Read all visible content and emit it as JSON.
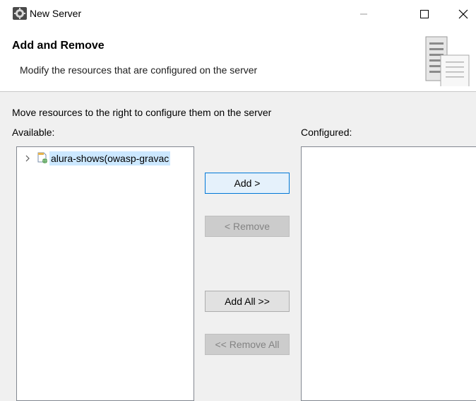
{
  "window": {
    "title": "New Server",
    "icons": {
      "app": "server-gear-icon",
      "minimize": "minimize-icon",
      "maximize": "maximize-icon",
      "close": "close-icon"
    }
  },
  "header": {
    "title": "Add and Remove",
    "description": "Modify the resources that are configured on the server",
    "banner_icon": "server-document-icon"
  },
  "body": {
    "instruction": "Move resources to the right to configure them on the server",
    "available_label": "Available:",
    "configured_label": "Configured:",
    "available_items": [
      {
        "label": "alura-shows(owasp-gravac",
        "icon": "web-project-icon",
        "expander": "chevron-right-icon",
        "selected": true
      }
    ],
    "configured_items": []
  },
  "buttons": {
    "add": {
      "label": "Add >",
      "enabled": true
    },
    "remove": {
      "label": "< Remove",
      "enabled": false
    },
    "add_all": {
      "label": "Add All >>",
      "enabled": true
    },
    "remove_all": {
      "label": "<< Remove All",
      "enabled": false
    }
  },
  "colors": {
    "selection": "#cce8ff",
    "default_button_border": "#0078d7",
    "dialog_background": "#f0f0f0"
  }
}
